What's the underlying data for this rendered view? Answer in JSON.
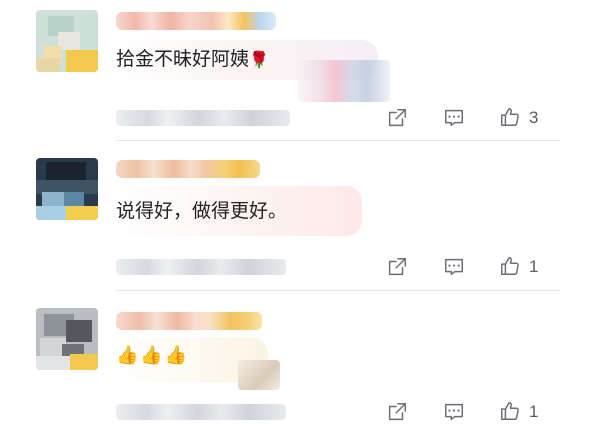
{
  "comments": [
    {
      "text": "拾金不昧好阿姨",
      "emoji": "🌹",
      "actions": {
        "share_icon": "share-icon",
        "reply_icon": "comment-icon",
        "like_icon": "like-icon",
        "like_count": "3"
      }
    },
    {
      "text": "说得好，做得更好。",
      "actions": {
        "share_icon": "share-icon",
        "reply_icon": "comment-icon",
        "like_icon": "like-icon",
        "like_count": "1"
      }
    },
    {
      "text": "👍👍👍",
      "actions": {
        "share_icon": "share-icon",
        "reply_icon": "comment-icon",
        "like_icon": "like-icon",
        "like_count": "1"
      }
    }
  ],
  "colors": {
    "background": "#ffffff",
    "icon": "#6b6f76",
    "bubble_pink": "#fdeeee",
    "name_blur_pink": "#f3b9a9",
    "name_blur_gold": "#f3c56a"
  }
}
